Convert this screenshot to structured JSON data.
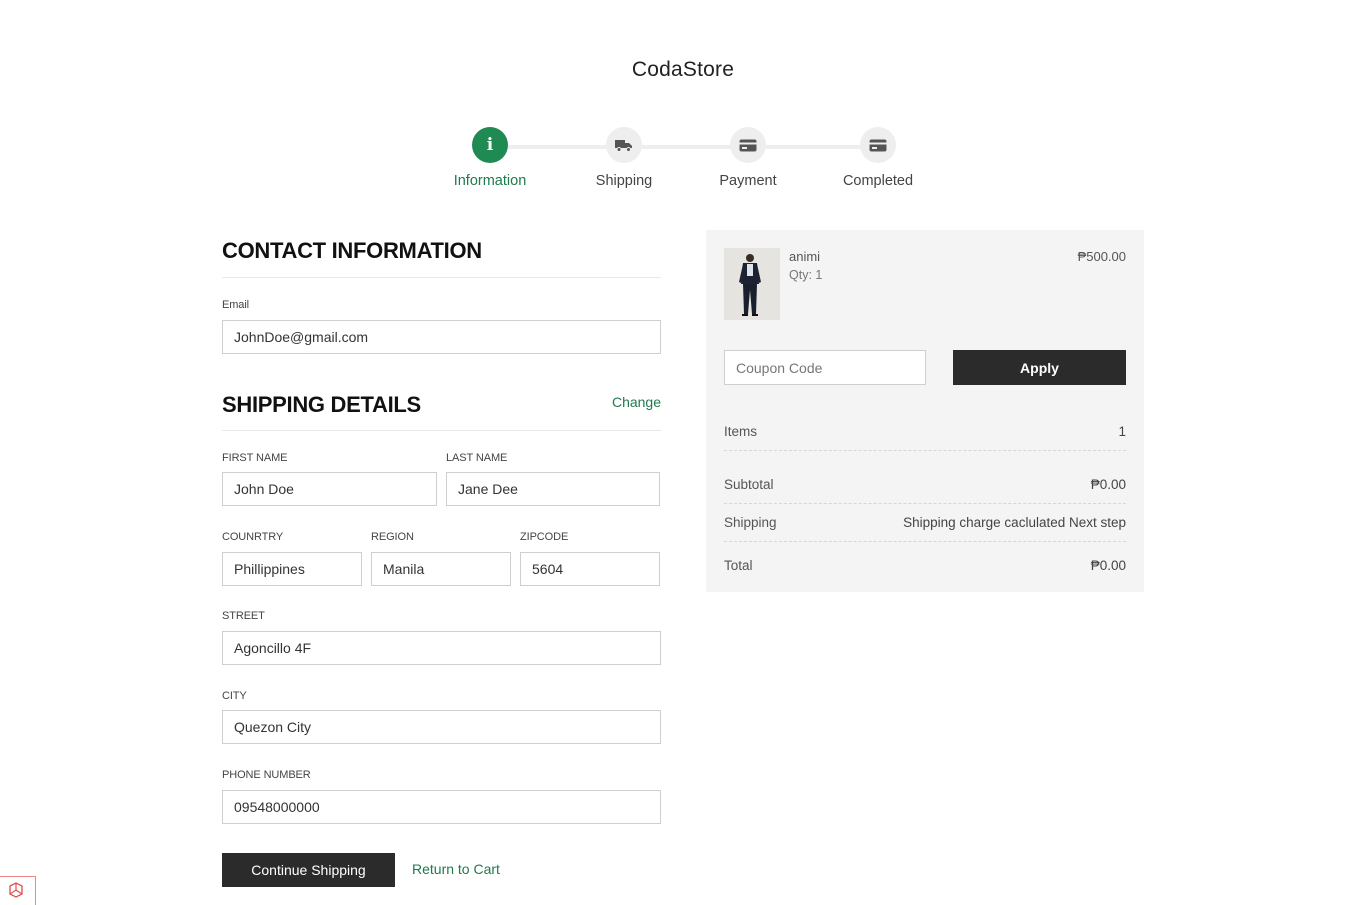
{
  "store": {
    "name": "CodaStore"
  },
  "stepper": {
    "steps": [
      {
        "label": "Information",
        "icon": "info-icon",
        "glyph": "i",
        "active": true
      },
      {
        "label": "Shipping",
        "icon": "truck-icon",
        "active": false
      },
      {
        "label": "Payment",
        "icon": "credit-card-icon",
        "active": false
      },
      {
        "label": "Completed",
        "icon": "credit-card-icon",
        "active": false
      }
    ]
  },
  "contact": {
    "title": "CONTACT INFORMATION",
    "email_label": "Email",
    "email_value": "JohnDoe@gmail.com"
  },
  "shipping": {
    "title": "SHIPPING DETAILS",
    "change_label": "Change",
    "first_name_label": "FIRST NAME",
    "first_name_value": "John Doe",
    "last_name_label": "LAST NAME",
    "last_name_value": "Jane Dee",
    "country_label": "COUNRTRY",
    "country_value": "Phillippines",
    "region_label": "REGION",
    "region_value": "Manila",
    "zipcode_label": "ZIPCODE",
    "zipcode_value": "5604",
    "street_label": "STREET",
    "street_value": "Agoncillo 4F",
    "city_label": "CITY",
    "city_value": "Quezon City",
    "phone_label": "PHONE NUMBER",
    "phone_value": "09548000000"
  },
  "actions": {
    "continue_label": "Continue Shipping",
    "return_label": "Return to Cart"
  },
  "summary": {
    "product": {
      "name": "animi",
      "qty": "Qty: 1",
      "price": "₱500.00"
    },
    "coupon_placeholder": "Coupon Code",
    "apply_label": "Apply",
    "items_label": "Items",
    "items_value": "1",
    "subtotal_label": "Subtotal",
    "subtotal_value": "₱0.00",
    "shipping_label": "Shipping",
    "shipping_value": "Shipping charge caclulated Next step",
    "total_label": "Total",
    "total_value": "₱0.00"
  },
  "colors": {
    "accent": "#1f8a52",
    "link": "#1f7a4c",
    "button": "#2b2b2b",
    "panel": "#f4f4f4"
  }
}
